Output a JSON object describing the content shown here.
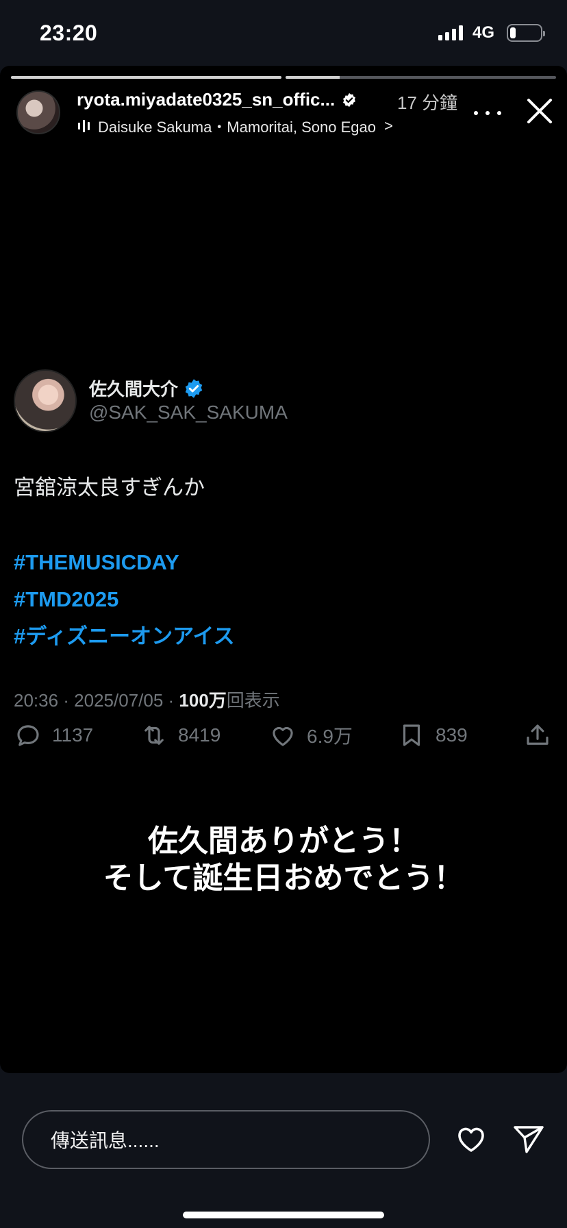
{
  "status_bar": {
    "time": "23:20",
    "network": "4G",
    "battery_level": 0.2
  },
  "story": {
    "progress": [
      1.0,
      0.2
    ],
    "username": "ryota.miyadate0325_sn_offic...",
    "time_ago": "17 分鐘",
    "music": "Daisuke Sakuma・Mamoritai, Sono Egao",
    "music_chevron": ">"
  },
  "tweet": {
    "display_name": "佐久間大介",
    "handle": "@SAK_SAK_SAKUMA",
    "text": "宮舘涼太良すぎんか",
    "hashtags": [
      "#THEMUSICDAY",
      "#TMD2025",
      "#ディズニーオンアイス"
    ],
    "meta_prefix": "20:36 · 2025/07/05 · ",
    "views_count": "100万",
    "views_label": "回表示",
    "replies": "1137",
    "retweets": "8419",
    "likes": "6.9万",
    "bookmarks": "839"
  },
  "caption": {
    "line1": "佐久間ありがとう！",
    "line2": "そして誕生日おめでとう！"
  },
  "message_bar": {
    "placeholder": "傳送訊息......"
  },
  "colors": {
    "accent_blue": "#1d9bf0",
    "muted_gray": "#71767b",
    "background": "#000000"
  }
}
